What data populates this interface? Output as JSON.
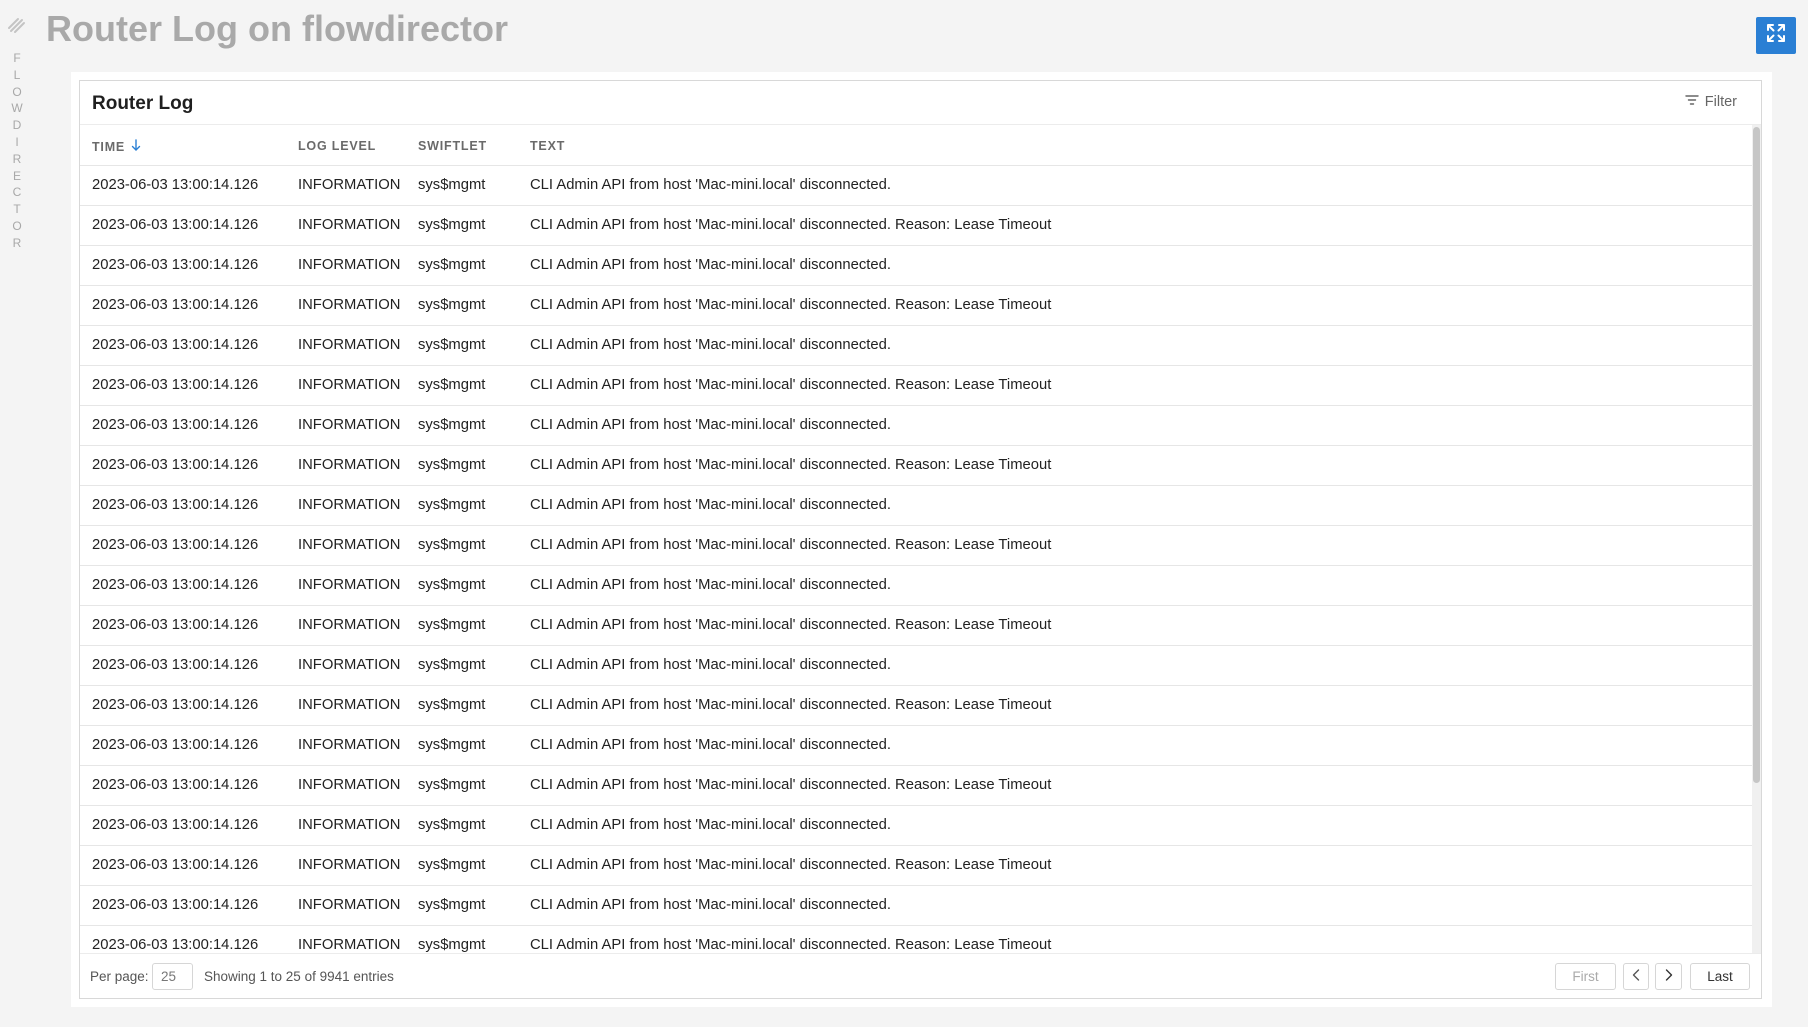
{
  "sidebar": {
    "logo_icon": "flowdirector-logo-icon",
    "letters": [
      "F",
      "L",
      "O",
      "W",
      "D",
      "I",
      "R",
      "E",
      "C",
      "T",
      "O",
      "R"
    ]
  },
  "page": {
    "title": "Router Log on flowdirector",
    "expand_icon": "expand-icon"
  },
  "card": {
    "title": "Router Log",
    "filter_label": "Filter",
    "filter_icon": "filter-icon"
  },
  "table": {
    "headers": {
      "time": "TIME",
      "log_level": "LOG LEVEL",
      "swiftlet": "SWIFTLET",
      "text": "TEXT"
    },
    "sort_icon": "arrow-down-icon",
    "rows": [
      {
        "time": "2023-06-03 13:00:14.126",
        "level": "INFORMATION",
        "swiftlet": "sys$mgmt",
        "text": "CLI Admin API from host 'Mac-mini.local' disconnected."
      },
      {
        "time": "2023-06-03 13:00:14.126",
        "level": "INFORMATION",
        "swiftlet": "sys$mgmt",
        "text": "CLI Admin API from host 'Mac-mini.local' disconnected. Reason: Lease Timeout"
      },
      {
        "time": "2023-06-03 13:00:14.126",
        "level": "INFORMATION",
        "swiftlet": "sys$mgmt",
        "text": "CLI Admin API from host 'Mac-mini.local' disconnected."
      },
      {
        "time": "2023-06-03 13:00:14.126",
        "level": "INFORMATION",
        "swiftlet": "sys$mgmt",
        "text": "CLI Admin API from host 'Mac-mini.local' disconnected. Reason: Lease Timeout"
      },
      {
        "time": "2023-06-03 13:00:14.126",
        "level": "INFORMATION",
        "swiftlet": "sys$mgmt",
        "text": "CLI Admin API from host 'Mac-mini.local' disconnected."
      },
      {
        "time": "2023-06-03 13:00:14.126",
        "level": "INFORMATION",
        "swiftlet": "sys$mgmt",
        "text": "CLI Admin API from host 'Mac-mini.local' disconnected. Reason: Lease Timeout"
      },
      {
        "time": "2023-06-03 13:00:14.126",
        "level": "INFORMATION",
        "swiftlet": "sys$mgmt",
        "text": "CLI Admin API from host 'Mac-mini.local' disconnected."
      },
      {
        "time": "2023-06-03 13:00:14.126",
        "level": "INFORMATION",
        "swiftlet": "sys$mgmt",
        "text": "CLI Admin API from host 'Mac-mini.local' disconnected. Reason: Lease Timeout"
      },
      {
        "time": "2023-06-03 13:00:14.126",
        "level": "INFORMATION",
        "swiftlet": "sys$mgmt",
        "text": "CLI Admin API from host 'Mac-mini.local' disconnected."
      },
      {
        "time": "2023-06-03 13:00:14.126",
        "level": "INFORMATION",
        "swiftlet": "sys$mgmt",
        "text": "CLI Admin API from host 'Mac-mini.local' disconnected. Reason: Lease Timeout"
      },
      {
        "time": "2023-06-03 13:00:14.126",
        "level": "INFORMATION",
        "swiftlet": "sys$mgmt",
        "text": "CLI Admin API from host 'Mac-mini.local' disconnected."
      },
      {
        "time": "2023-06-03 13:00:14.126",
        "level": "INFORMATION",
        "swiftlet": "sys$mgmt",
        "text": "CLI Admin API from host 'Mac-mini.local' disconnected. Reason: Lease Timeout"
      },
      {
        "time": "2023-06-03 13:00:14.126",
        "level": "INFORMATION",
        "swiftlet": "sys$mgmt",
        "text": "CLI Admin API from host 'Mac-mini.local' disconnected."
      },
      {
        "time": "2023-06-03 13:00:14.126",
        "level": "INFORMATION",
        "swiftlet": "sys$mgmt",
        "text": "CLI Admin API from host 'Mac-mini.local' disconnected. Reason: Lease Timeout"
      },
      {
        "time": "2023-06-03 13:00:14.126",
        "level": "INFORMATION",
        "swiftlet": "sys$mgmt",
        "text": "CLI Admin API from host 'Mac-mini.local' disconnected."
      },
      {
        "time": "2023-06-03 13:00:14.126",
        "level": "INFORMATION",
        "swiftlet": "sys$mgmt",
        "text": "CLI Admin API from host 'Mac-mini.local' disconnected. Reason: Lease Timeout"
      },
      {
        "time": "2023-06-03 13:00:14.126",
        "level": "INFORMATION",
        "swiftlet": "sys$mgmt",
        "text": "CLI Admin API from host 'Mac-mini.local' disconnected."
      },
      {
        "time": "2023-06-03 13:00:14.126",
        "level": "INFORMATION",
        "swiftlet": "sys$mgmt",
        "text": "CLI Admin API from host 'Mac-mini.local' disconnected. Reason: Lease Timeout"
      },
      {
        "time": "2023-06-03 13:00:14.126",
        "level": "INFORMATION",
        "swiftlet": "sys$mgmt",
        "text": "CLI Admin API from host 'Mac-mini.local' disconnected."
      },
      {
        "time": "2023-06-03 13:00:14.126",
        "level": "INFORMATION",
        "swiftlet": "sys$mgmt",
        "text": "CLI Admin API from host 'Mac-mini.local' disconnected. Reason: Lease Timeout"
      }
    ]
  },
  "footer": {
    "per_page_label": "Per page:",
    "per_page_value": "25",
    "showing": "Showing 1 to 25 of 9941 entries",
    "first_label": "First",
    "last_label": "Last",
    "prev_icon": "chevron-left-icon",
    "next_icon": "chevron-right-icon"
  },
  "colors": {
    "accent": "#2a7fd4",
    "title_gray": "#a9a9a9",
    "background": "#f4f4f4"
  }
}
